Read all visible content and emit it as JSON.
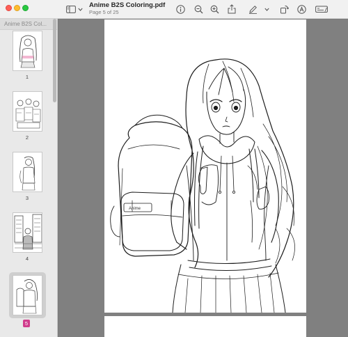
{
  "window": {
    "title": "Anime B2S Coloring.pdf",
    "subtitle": "Page 5 of 25"
  },
  "toolbar": {
    "icons": [
      "sidebar-toggle-icon",
      "chevron-down-icon",
      "info-icon",
      "zoom-out-icon",
      "zoom-in-icon",
      "share-icon",
      "markup-pen-icon",
      "chevron-down-icon",
      "rotate-icon",
      "markup-circle-icon",
      "form-fill-icon"
    ]
  },
  "sidebar": {
    "header": "Anime B2S Col...",
    "thumbnails": [
      {
        "label": "1"
      },
      {
        "label": "2"
      },
      {
        "label": "3"
      },
      {
        "label": "4"
      },
      {
        "label": "5",
        "selected": true
      }
    ],
    "accent_color": "#d03c8c"
  },
  "page": {
    "backpack_tag": "Anime"
  }
}
